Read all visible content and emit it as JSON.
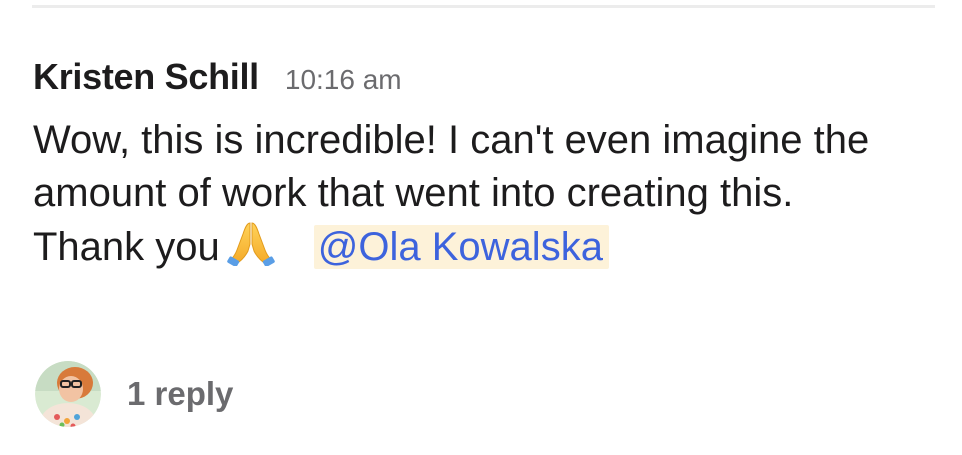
{
  "message": {
    "author": "Kristen Schill",
    "timestamp": "10:16 am",
    "text_before_emoji": "Wow, this is incredible! I can't even imagine the amount of work that went into creating this.  Thank you",
    "emoji_icon": "folded-hands-icon",
    "mention": "@Ola Kowalska"
  },
  "thread": {
    "reply_count_label": "1 reply",
    "avatar_icon": "user-avatar"
  },
  "colors": {
    "mention_text": "#3d63dd",
    "mention_bg": "#fdf2d9",
    "muted_text": "#6b6b6e",
    "body_text": "#1d1c1d"
  }
}
